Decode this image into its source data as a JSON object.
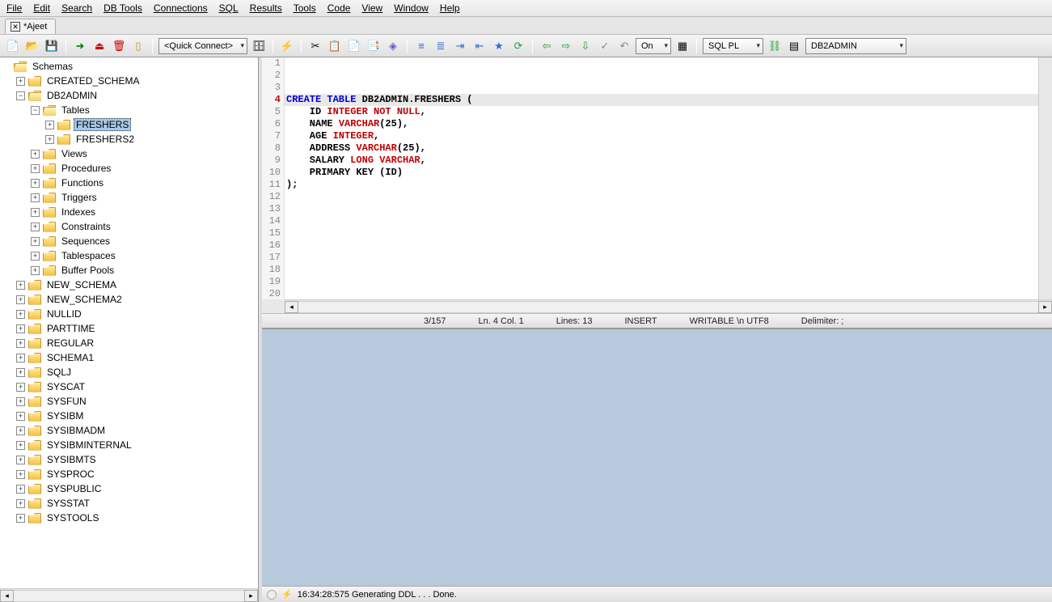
{
  "menus": [
    "File",
    "Edit",
    "Search",
    "DB Tools",
    "Connections",
    "SQL",
    "Results",
    "Tools",
    "Code",
    "View",
    "Window",
    "Help"
  ],
  "tab": {
    "label": "*Ajeet"
  },
  "toolbar": {
    "quick_connect": "<Quick Connect>",
    "line_break": "On",
    "lang": "SQL PL",
    "schema": "DB2ADMIN"
  },
  "tree": {
    "root": "Schemas",
    "items": [
      {
        "label": "CREATED_SCHEMA",
        "expanded": false,
        "level": 1,
        "type": "plus"
      },
      {
        "label": "DB2ADMIN",
        "expanded": true,
        "level": 1,
        "type": "minus",
        "children": [
          {
            "label": "Tables",
            "expanded": true,
            "level": 2,
            "type": "minus",
            "children": [
              {
                "label": "FRESHERS",
                "expanded": false,
                "level": 3,
                "type": "plus",
                "selected": true
              },
              {
                "label": "FRESHERS2",
                "expanded": false,
                "level": 3,
                "type": "plus"
              }
            ]
          },
          {
            "label": "Views",
            "level": 2,
            "type": "plus"
          },
          {
            "label": "Procedures",
            "level": 2,
            "type": "plus"
          },
          {
            "label": "Functions",
            "level": 2,
            "type": "plus"
          },
          {
            "label": "Triggers",
            "level": 2,
            "type": "plus"
          },
          {
            "label": "Indexes",
            "level": 2,
            "type": "plus"
          },
          {
            "label": "Constraints",
            "level": 2,
            "type": "plus"
          },
          {
            "label": "Sequences",
            "level": 2,
            "type": "plus"
          },
          {
            "label": "Tablespaces",
            "level": 2,
            "type": "plus"
          },
          {
            "label": "Buffer Pools",
            "level": 2,
            "type": "plus"
          }
        ]
      },
      {
        "label": "NEW_SCHEMA",
        "level": 1,
        "type": "plus"
      },
      {
        "label": "NEW_SCHEMA2",
        "level": 1,
        "type": "plus"
      },
      {
        "label": "NULLID",
        "level": 1,
        "type": "plus"
      },
      {
        "label": "PARTTIME",
        "level": 1,
        "type": "plus"
      },
      {
        "label": "REGULAR",
        "level": 1,
        "type": "plus"
      },
      {
        "label": "SCHEMA1",
        "level": 1,
        "type": "plus"
      },
      {
        "label": "SQLJ",
        "level": 1,
        "type": "plus"
      },
      {
        "label": "SYSCAT",
        "level": 1,
        "type": "plus"
      },
      {
        "label": "SYSFUN",
        "level": 1,
        "type": "plus"
      },
      {
        "label": "SYSIBM",
        "level": 1,
        "type": "plus"
      },
      {
        "label": "SYSIBMADM",
        "level": 1,
        "type": "plus"
      },
      {
        "label": "SYSIBMINTERNAL",
        "level": 1,
        "type": "plus"
      },
      {
        "label": "SYSIBMTS",
        "level": 1,
        "type": "plus"
      },
      {
        "label": "SYSPROC",
        "level": 1,
        "type": "plus"
      },
      {
        "label": "SYSPUBLIC",
        "level": 1,
        "type": "plus"
      },
      {
        "label": "SYSSTAT",
        "level": 1,
        "type": "plus"
      },
      {
        "label": "SYSTOOLS",
        "level": 1,
        "type": "plus"
      }
    ]
  },
  "editor": {
    "lines": [
      {
        "n": 1,
        "tokens": []
      },
      {
        "n": 2,
        "tokens": []
      },
      {
        "n": 3,
        "tokens": []
      },
      {
        "n": 4,
        "hl": true,
        "tokens": [
          {
            "t": "CREATE TABLE",
            "c": "kw-blue"
          },
          {
            "t": " DB2ADMIN.FRESHERS (",
            "c": ""
          }
        ]
      },
      {
        "n": 5,
        "tokens": [
          {
            "t": "    ID ",
            "c": ""
          },
          {
            "t": "INTEGER NOT NULL",
            "c": "kw-red"
          },
          {
            "t": ",",
            "c": ""
          }
        ]
      },
      {
        "n": 6,
        "tokens": [
          {
            "t": "    NAME ",
            "c": ""
          },
          {
            "t": "VARCHAR",
            "c": "kw-red"
          },
          {
            "t": "(25),",
            "c": ""
          }
        ]
      },
      {
        "n": 7,
        "tokens": [
          {
            "t": "    AGE ",
            "c": ""
          },
          {
            "t": "INTEGER",
            "c": "kw-red"
          },
          {
            "t": ",",
            "c": ""
          }
        ]
      },
      {
        "n": 8,
        "tokens": [
          {
            "t": "    ADDRESS ",
            "c": ""
          },
          {
            "t": "VARCHAR",
            "c": "kw-red"
          },
          {
            "t": "(25),",
            "c": ""
          }
        ]
      },
      {
        "n": 9,
        "tokens": [
          {
            "t": "    SALARY ",
            "c": ""
          },
          {
            "t": "LONG VARCHAR",
            "c": "kw-red"
          },
          {
            "t": ",",
            "c": ""
          }
        ]
      },
      {
        "n": 10,
        "tokens": [
          {
            "t": "    PRIMARY KEY (ID)",
            "c": ""
          }
        ]
      },
      {
        "n": 11,
        "tokens": [
          {
            "t": ");",
            "c": ""
          }
        ]
      },
      {
        "n": 12,
        "tokens": []
      },
      {
        "n": 13,
        "tokens": []
      },
      {
        "n": 14,
        "tokens": []
      },
      {
        "n": 15,
        "tokens": []
      },
      {
        "n": 16,
        "tokens": []
      },
      {
        "n": 17,
        "tokens": []
      },
      {
        "n": 18,
        "tokens": []
      },
      {
        "n": 19,
        "tokens": []
      },
      {
        "n": 20,
        "tokens": []
      }
    ],
    "current_line": 4
  },
  "editor_status": {
    "pos": "3/157",
    "loc": "Ln. 4 Col. 1",
    "lines": "Lines: 13",
    "mode": "INSERT",
    "write": "WRITABLE \\n  UTF8",
    "delim": "Delimiter: ;"
  },
  "bottom_status": "16:34:28:575 Generating DDL . . . Done."
}
